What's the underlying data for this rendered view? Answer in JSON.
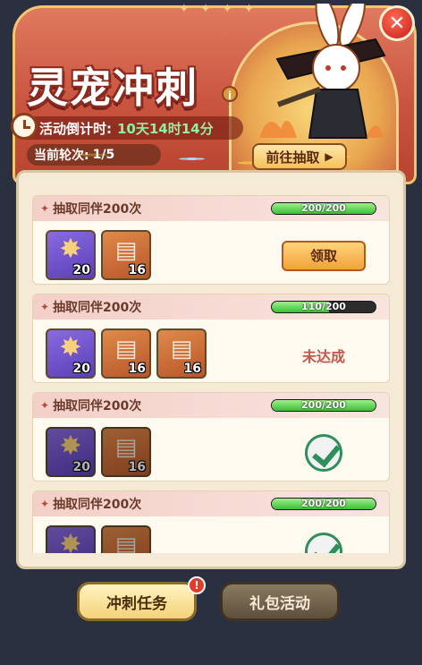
{
  "header": {
    "title": "灵宠冲刺",
    "countdown_label": "活动倒计时:",
    "countdown_value": "10天14时14分",
    "round_label": "当前轮次:",
    "round_value": "1/5",
    "goto_label": "前往抽取",
    "close_icon": "close-icon",
    "info_icon": "info-icon"
  },
  "tasks": [
    {
      "title": "抽取同伴200次",
      "progress_text": "200/200",
      "progress": 1.0,
      "rewards": [
        {
          "icon": "star-badge-icon",
          "qty": "20"
        },
        {
          "icon": "ticket-icon",
          "qty": "16"
        }
      ],
      "state": "claim",
      "action_label": "领取"
    },
    {
      "title": "抽取同伴200次",
      "progress_text": "110/200",
      "progress": 0.55,
      "rewards": [
        {
          "icon": "star-badge-icon",
          "qty": "20"
        },
        {
          "icon": "ticket-icon",
          "qty": "16"
        },
        {
          "icon": "ticket-icon",
          "qty": "16"
        }
      ],
      "state": "incomplete",
      "action_label": "未达成"
    },
    {
      "title": "抽取同伴200次",
      "progress_text": "200/200",
      "progress": 1.0,
      "rewards": [
        {
          "icon": "star-badge-icon",
          "qty": "20"
        },
        {
          "icon": "ticket-icon",
          "qty": "16"
        }
      ],
      "state": "claimed"
    },
    {
      "title": "抽取同伴200次",
      "progress_text": "200/200",
      "progress": 1.0,
      "rewards": [
        {
          "icon": "star-badge-icon",
          "qty": ""
        },
        {
          "icon": "ticket-icon",
          "qty": ""
        }
      ],
      "state": "claimed"
    }
  ],
  "tabs": [
    {
      "label": "冲刺任务",
      "active": true,
      "badge": "!"
    },
    {
      "label": "礼包活动",
      "active": false
    }
  ]
}
